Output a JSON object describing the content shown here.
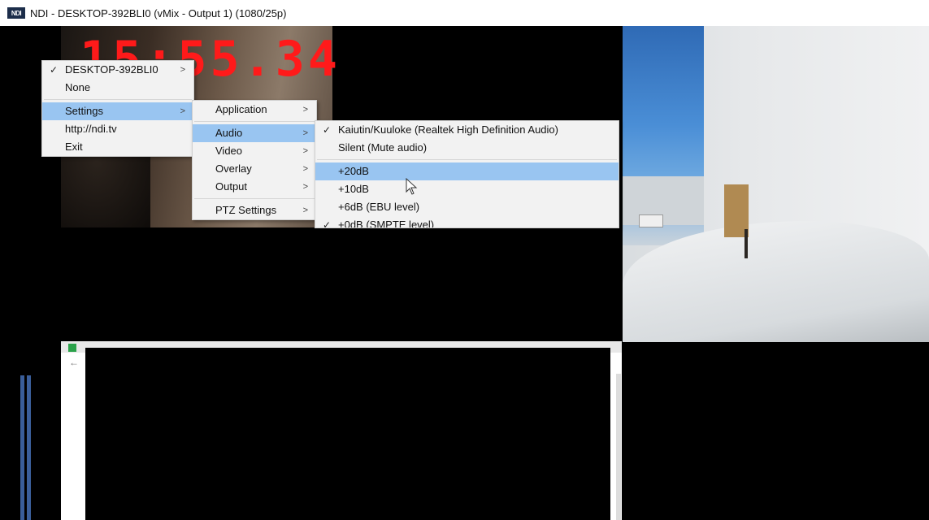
{
  "window": {
    "icon_label": "NDI",
    "title": "NDI - DESKTOP-392BLI0 (vMix - Output 1) (1080/25p)"
  },
  "video": {
    "clock": "15:55.34"
  },
  "menus": {
    "main": [
      {
        "label": "DESKTOP-392BLI0",
        "checked": true,
        "submenu": true
      },
      {
        "label": "None"
      },
      {
        "label": "Settings",
        "submenu": true,
        "highlighted": true
      },
      {
        "label": "http://ndi.tv"
      },
      {
        "label": "Exit"
      }
    ],
    "settings": [
      {
        "label": "Application",
        "submenu": true
      },
      {
        "label": "Audio",
        "submenu": true,
        "highlighted": true
      },
      {
        "label": "Video",
        "submenu": true
      },
      {
        "label": "Overlay",
        "submenu": true
      },
      {
        "label": "Output",
        "submenu": true
      },
      {
        "label": "PTZ Settings",
        "submenu": true
      }
    ],
    "audio": [
      {
        "label": "Kaiutin/Kuuloke (Realtek High Definition Audio)",
        "checked": true
      },
      {
        "label": "Silent (Mute audio)"
      },
      {
        "label": "+20dB",
        "highlighted": true
      },
      {
        "label": "+10dB"
      },
      {
        "label": "+6dB (EBU level)"
      },
      {
        "label": "+0dB (SMPTE level)",
        "checked": true
      }
    ]
  },
  "glyphs": {
    "check": "✓",
    "arrow": ">",
    "back": "←"
  },
  "colors": {
    "highlight": "#99c5f1",
    "clock": "#ff1a1a"
  }
}
